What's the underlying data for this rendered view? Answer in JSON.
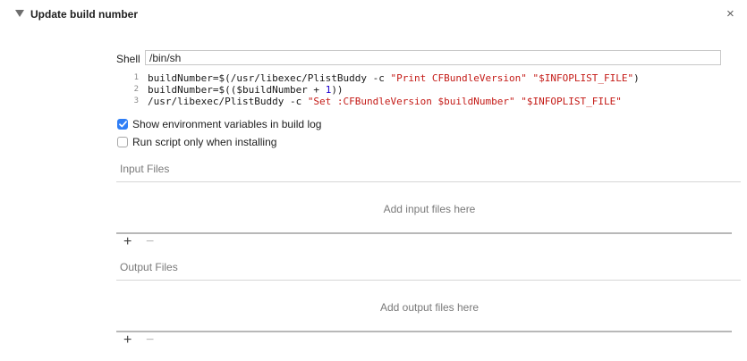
{
  "phase": {
    "title": "Update build number",
    "close_glyph": "×"
  },
  "shell": {
    "label": "Shell",
    "value": "/bin/sh"
  },
  "script_lines": [
    {
      "number": "1",
      "parts": [
        {
          "text": "buildNumber=$(/usr/libexec/PlistBuddy -c ",
          "kind": "plain"
        },
        {
          "text": "\"Print CFBundleVersion\"",
          "kind": "string"
        },
        {
          "text": " ",
          "kind": "plain"
        },
        {
          "text": "\"$INFOPLIST_FILE\"",
          "kind": "string"
        },
        {
          "text": ")",
          "kind": "plain"
        }
      ]
    },
    {
      "number": "2",
      "parts": [
        {
          "text": "buildNumber=$(($buildNumber + ",
          "kind": "plain"
        },
        {
          "text": "1",
          "kind": "number"
        },
        {
          "text": "))",
          "kind": "plain"
        }
      ]
    },
    {
      "number": "3",
      "parts": [
        {
          "text": "/usr/libexec/PlistBuddy -c ",
          "kind": "plain"
        },
        {
          "text": "\"Set :CFBundleVersion $buildNumber\"",
          "kind": "string"
        },
        {
          "text": " ",
          "kind": "plain"
        },
        {
          "text": "\"$INFOPLIST_FILE\"",
          "kind": "string"
        }
      ]
    }
  ],
  "options": {
    "show_env": {
      "label": "Show environment variables in build log",
      "checked": true
    },
    "run_when_installing": {
      "label": "Run script only when installing",
      "checked": false
    }
  },
  "input_files": {
    "label": "Input Files",
    "placeholder": "Add input files here",
    "add": "+",
    "remove": "−"
  },
  "output_files": {
    "label": "Output Files",
    "placeholder": "Add output files here",
    "add": "+",
    "remove": "−"
  },
  "colors": {
    "checkbox_accent": "#2f7ef6",
    "string": "#c41a16",
    "number": "#1c00cf"
  }
}
